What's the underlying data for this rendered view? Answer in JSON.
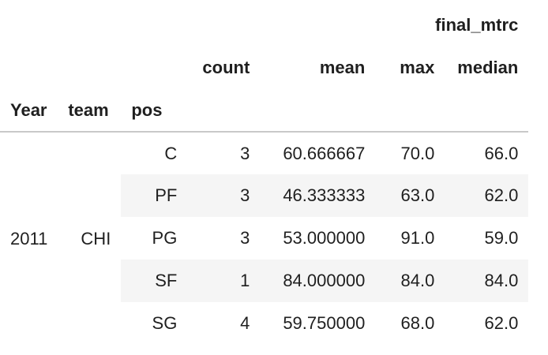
{
  "header": {
    "group_label": "final_mtrc",
    "columns": [
      "count",
      "mean",
      "max",
      "median"
    ],
    "index_names": [
      "Year",
      "team",
      "pos"
    ]
  },
  "index": {
    "year": "2011",
    "team": "CHI"
  },
  "rows": [
    {
      "pos": "C",
      "count": "3",
      "mean": "60.666667",
      "max": "70.0",
      "median": "66.0"
    },
    {
      "pos": "PF",
      "count": "3",
      "mean": "46.333333",
      "max": "63.0",
      "median": "62.0"
    },
    {
      "pos": "PG",
      "count": "3",
      "mean": "53.000000",
      "max": "91.0",
      "median": "59.0"
    },
    {
      "pos": "SF",
      "count": "1",
      "mean": "84.000000",
      "max": "84.0",
      "median": "84.0"
    },
    {
      "pos": "SG",
      "count": "4",
      "mean": "59.750000",
      "max": "68.0",
      "median": "62.0"
    }
  ]
}
